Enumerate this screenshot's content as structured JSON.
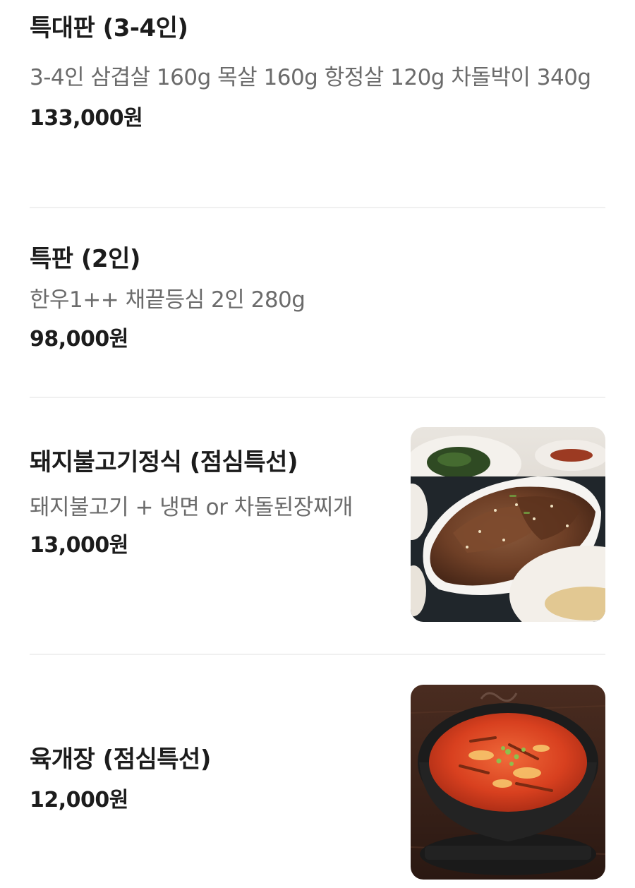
{
  "menu": {
    "items": [
      {
        "title": "특대판 (3-4인)",
        "description": "3-4인 삼겹살 160g 목살 160g 항정살 120g 차돌박이 340g",
        "price": "133,000원"
      },
      {
        "title": "특판 (2인)",
        "description": "한우1++ 채끝등심 2인 280g",
        "price": "98,000원"
      },
      {
        "title": "돼지불고기정식 (점심특선)",
        "description": "돼지불고기 + 냉면 or 차돌된장찌개",
        "price": "13,000원",
        "photo": "pork-bulgogi-set-photo"
      },
      {
        "title": "육개장 (점심특선)",
        "price": "12,000원",
        "photo": "yukgaejang-photo"
      }
    ]
  },
  "colors": {
    "title": "#1c1c1c",
    "description": "#6b6b6b",
    "divider": "#f0f0f0",
    "background": "#ffffff"
  }
}
